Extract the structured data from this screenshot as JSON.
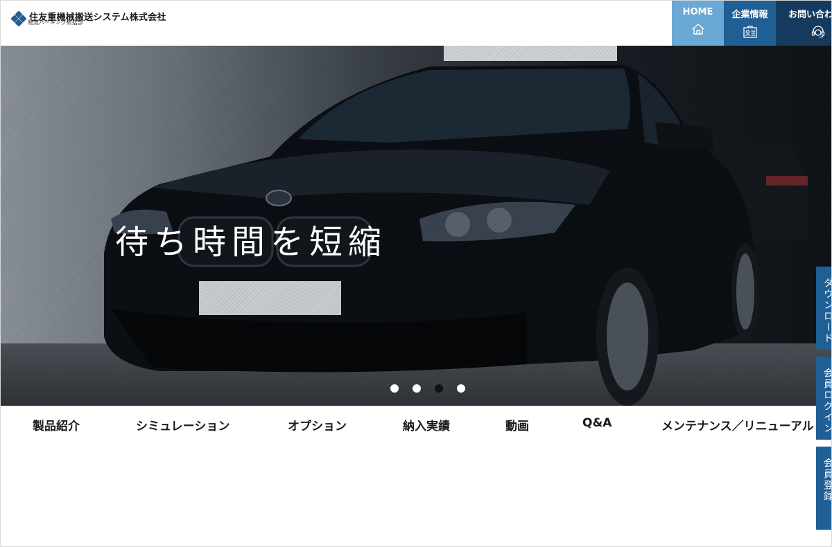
{
  "header": {
    "company_name": "住友重機械搬送システム株式会社",
    "division": "物流パーキング統括部",
    "nav": {
      "home": "HOME",
      "company_info": "企業情報",
      "contact": "お問い合わせ"
    }
  },
  "hero": {
    "headline": "待ち時間を短縮",
    "slide_count": 4,
    "active_slide": 3
  },
  "main_nav": {
    "items": [
      "製品紹介",
      "シミュレーション",
      "オプション",
      "納入実績",
      "動画",
      "Q&A",
      "メンテナンス／リニューアル"
    ]
  },
  "side_tabs": {
    "download": "ダウンロード",
    "member_login": "会員ログイン",
    "member_register": "会員登録"
  },
  "colors": {
    "home_button": "#6aa8d6",
    "company_button": "#1f5f94",
    "contact_button": "#163a5e",
    "side_tab": "#1f5f94"
  }
}
